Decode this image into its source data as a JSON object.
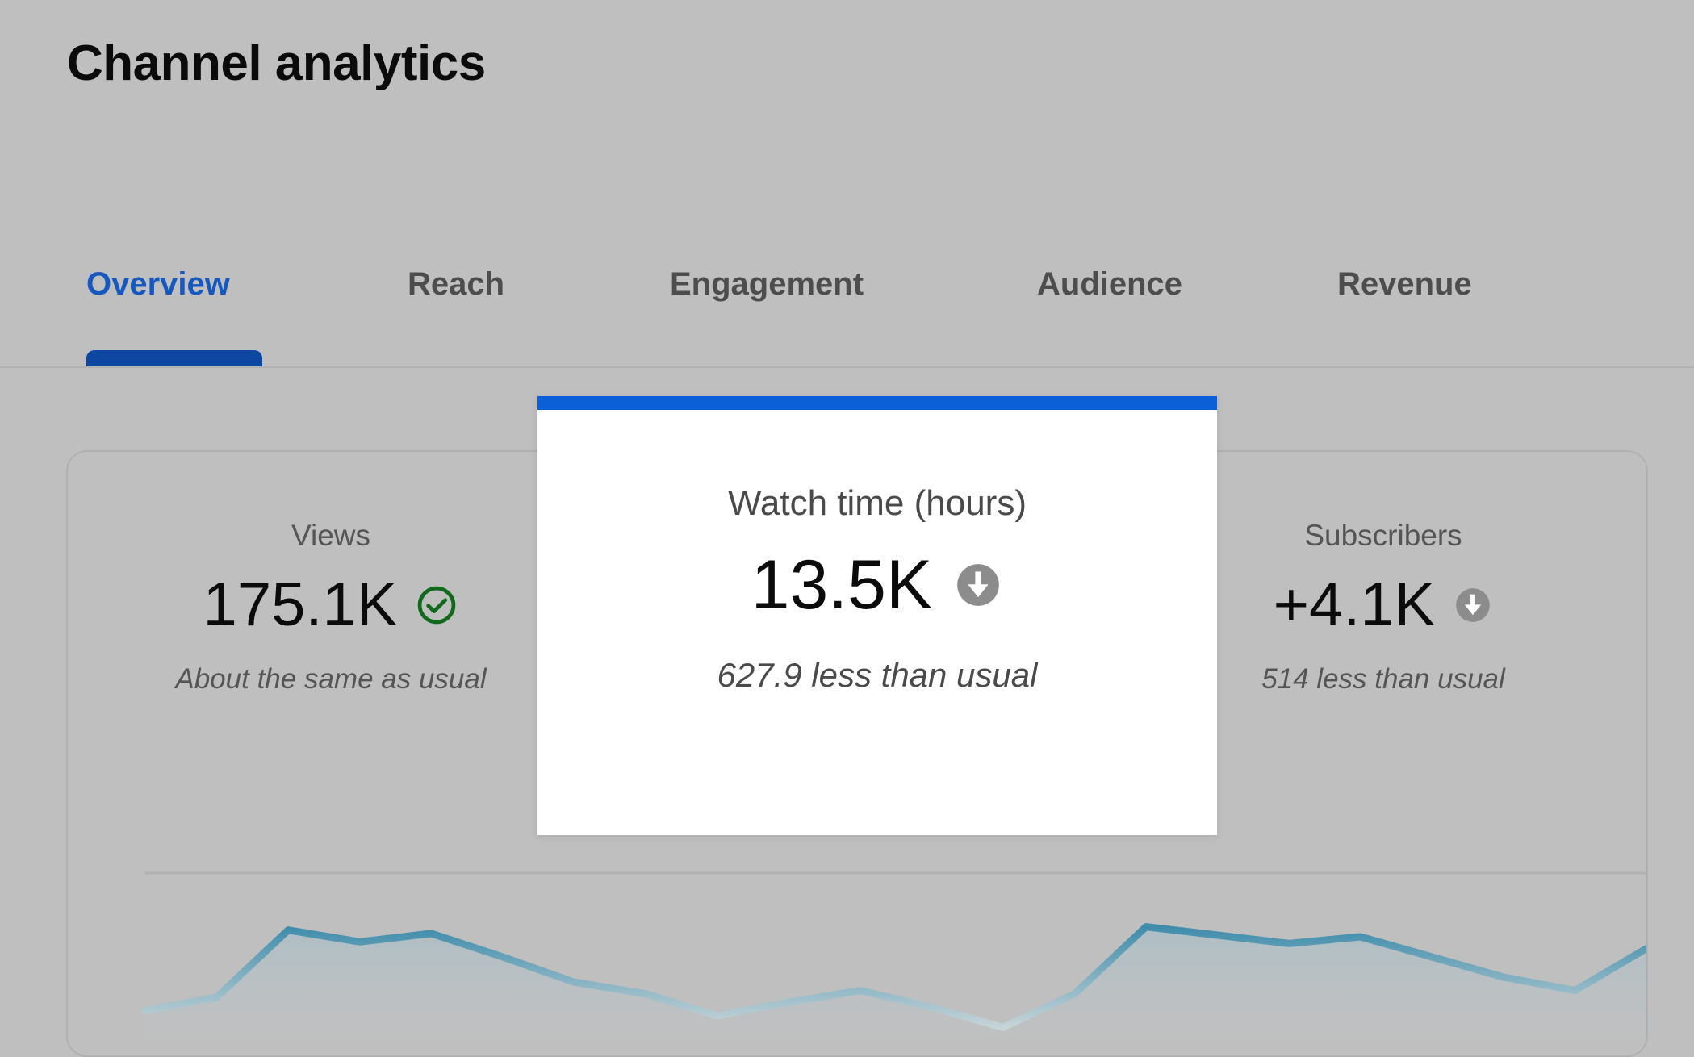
{
  "page": {
    "title": "Channel analytics"
  },
  "tabs": {
    "items": [
      {
        "label": "Overview",
        "active": true
      },
      {
        "label": "Reach",
        "active": false
      },
      {
        "label": "Engagement",
        "active": false
      },
      {
        "label": "Audience",
        "active": false
      },
      {
        "label": "Revenue",
        "active": false
      }
    ]
  },
  "metrics": [
    {
      "label": "Views",
      "value": "175.1K",
      "trend_icon": "check-circle-icon",
      "trend_color": "#11691b",
      "comparison": "About the same as usual"
    },
    {
      "label": "Watch time (hours)",
      "value": "13.5K",
      "trend_icon": "arrow-down-circle-icon",
      "trend_color": "#8c8c8c",
      "comparison": "627.9 less than usual"
    },
    {
      "label": "Subscribers",
      "value": "+4.1K",
      "trend_icon": "arrow-down-circle-icon",
      "trend_color": "#8c8c8c",
      "comparison": "514 less than usual"
    }
  ],
  "detail_card": {
    "accent_color": "#0b5fd7",
    "title": "Watch time (hours)",
    "value": "13.5K",
    "trend_icon": "arrow-down-circle-icon",
    "comparison": "627.9 less than usual"
  },
  "colors": {
    "background": "#bfbfbf",
    "active_tab": "#1558c0",
    "tab_underline": "#0e47a1",
    "inactive_tab": "#4d4d4d",
    "chart_line": "#4e93ad",
    "positive": "#11691b",
    "negative": "#8c8c8c"
  },
  "chart_data": {
    "type": "area",
    "title": "",
    "xlabel": "",
    "ylabel": "",
    "grid": true,
    "gridlines_y": [
      1
    ],
    "legend": "none",
    "series": [
      {
        "name": "Watch time (hours)",
        "x": [
          0,
          1,
          2,
          3,
          4,
          5,
          6,
          7,
          8,
          9,
          10,
          11,
          12,
          13,
          14,
          15,
          16,
          17,
          18,
          19,
          20,
          21
        ],
        "values": [
          18,
          26,
          66,
          59,
          64,
          50,
          35,
          28,
          15,
          23,
          30,
          20,
          8,
          28,
          68,
          63,
          58,
          62,
          50,
          38,
          30,
          55
        ]
      }
    ],
    "ylim": [
      0,
      100
    ],
    "xlim": [
      0,
      21
    ]
  }
}
